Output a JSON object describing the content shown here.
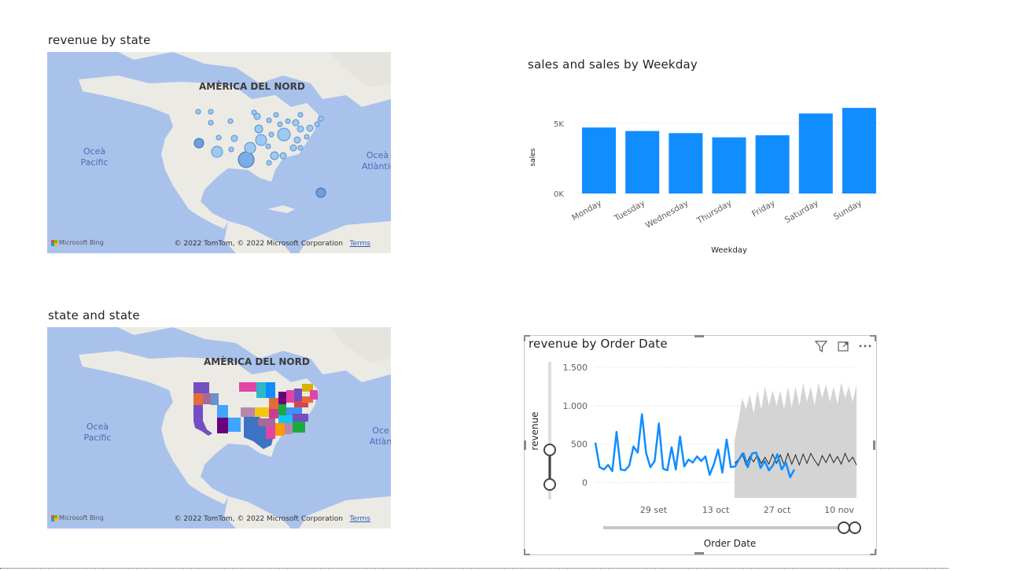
{
  "map1": {
    "title": "revenue by state",
    "region_label": "AMÈRICA DEL NORD",
    "ocean_left": "Oceà\nPacific",
    "ocean_right": "Oceà\nAtlàntic",
    "bing": "Microsoft Bing",
    "copyright": "© 2022 TomTom, © 2022 Microsoft Corporation",
    "terms": "Terms"
  },
  "map2": {
    "title": "state and state",
    "region_label": "AMÈRICA DEL NORD",
    "ocean_left": "Oceà\nPacific",
    "ocean_right": "Oce\nAtlàn",
    "bing": "Microsoft Bing",
    "copyright": "© 2022 TomTom, © 2022 Microsoft Corporation",
    "terms": "Terms"
  },
  "bar_chart": {
    "title": "sales and sales by Weekday"
  },
  "line_chart": {
    "title": "revenue by Order Date",
    "icons": [
      "filter-icon",
      "focus-mode-icon",
      "more-options-icon"
    ]
  },
  "colors": {
    "bar": "#118dff",
    "line": "#118dff",
    "forecast_band": "#d4d4d4",
    "forecast_line": "#252423",
    "map_water": "#a9c2ec",
    "map_land": "#eceae4",
    "bubble": "#9ec9f2"
  },
  "chart_data": [
    {
      "type": "bar",
      "title": "sales and sales by Weekday",
      "xlabel": "Weekday",
      "ylabel": "sales",
      "categories": [
        "Monday",
        "Tuesday",
        "Wednesday",
        "Thursday",
        "Friday",
        "Saturday",
        "Sunday"
      ],
      "values": [
        4700,
        4450,
        4300,
        4000,
        4150,
        5700,
        6100
      ],
      "yticks": [
        "0K",
        "5K"
      ],
      "ytick_values": [
        0,
        5000
      ],
      "ylim": [
        0,
        6500
      ],
      "grid": true
    },
    {
      "type": "line",
      "title": "revenue by Order Date",
      "xlabel": "Order Date",
      "ylabel": "revenue",
      "xticks": [
        "29 set",
        "13 oct",
        "27 oct",
        "10 nov"
      ],
      "yticks": [
        "1.500",
        "1.000",
        "500",
        "0"
      ],
      "ytick_values": [
        1500,
        1000,
        500,
        0
      ],
      "ylim": [
        -250,
        1500
      ],
      "series": [
        {
          "values": [
            520,
            200,
            170,
            230,
            150,
            660,
            170,
            160,
            220,
            470,
            390,
            890,
            380,
            200,
            280,
            770,
            180,
            160,
            460,
            170,
            600,
            210,
            300,
            260,
            340,
            280,
            340,
            100,
            240,
            430,
            130,
            560,
            200,
            210,
            310,
            380,
            200,
            380,
            390,
            190,
            280,
            160,
            230,
            370,
            170,
            260,
            70,
            170
          ]
        },
        {
          "forecast_line": [
            250,
            300,
            380,
            230,
            340,
            270,
            360,
            250,
            330,
            240,
            370,
            250,
            360,
            230,
            380,
            240,
            360,
            230,
            370,
            250,
            380,
            290,
            220,
            350,
            260,
            370,
            260,
            340,
            240,
            380,
            270,
            330,
            230
          ],
          "forecast_upper": [
            550,
            800,
            1100,
            950,
            1150,
            900,
            1200,
            950,
            1250,
            1000,
            1200,
            1000,
            1200,
            950,
            1250,
            980,
            1250,
            1000,
            1300,
            1050,
            1250,
            1000,
            1300,
            1100,
            1280,
            1050,
            1250,
            1020,
            1300,
            1100,
            1250,
            1050,
            1280
          ],
          "forecast_lower": [
            -200,
            -200,
            -200,
            -200,
            -200,
            -200,
            -200,
            -200,
            -200,
            -200,
            -200,
            -200,
            -200,
            -200,
            -200,
            -200,
            -200,
            -200,
            -200,
            -200,
            -200,
            -200,
            -200,
            -200,
            -200,
            -200,
            -200,
            -200,
            -200,
            -200,
            -200,
            -200,
            -200
          ]
        }
      ]
    }
  ]
}
